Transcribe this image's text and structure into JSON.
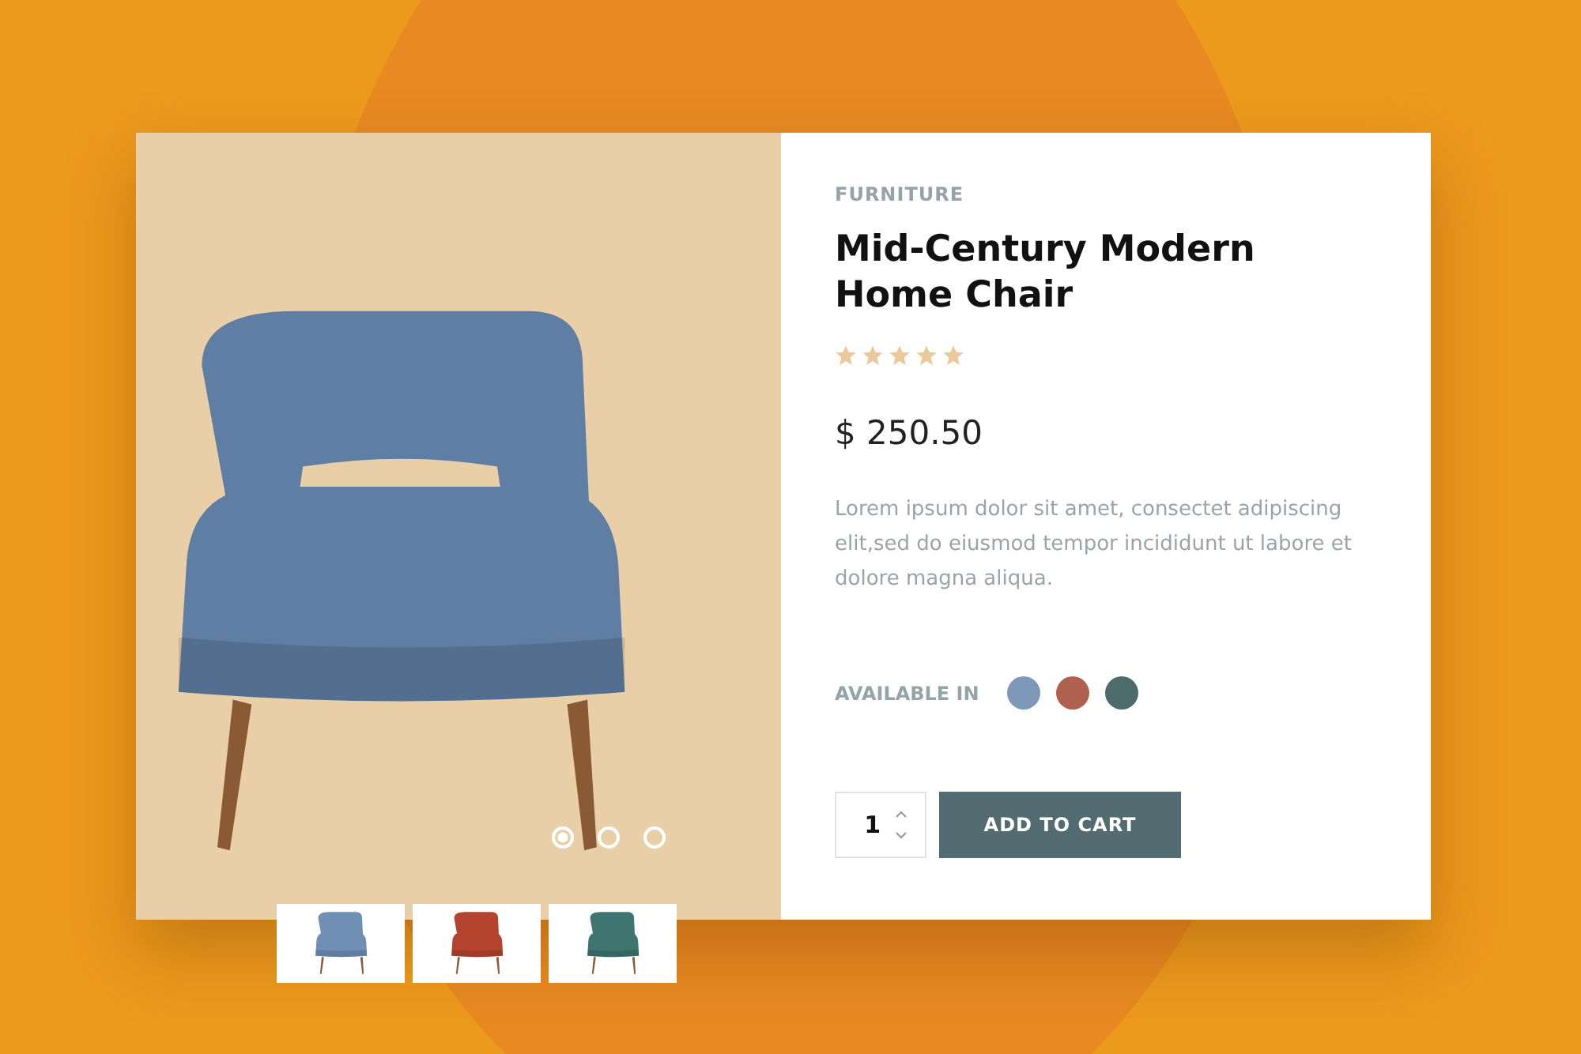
{
  "product": {
    "category": "FURNITURE",
    "title": "Mid-Century Modern Home Chair",
    "stars": 5,
    "price": "$ 250.50",
    "description": "Lorem ipsum dolor sit amet, consectet adipiscing elit,sed do eiusmod tempor incididunt ut labore et dolore magna aliqua."
  },
  "gallery": {
    "slides": [
      {
        "selected": true
      },
      {
        "selected": false
      },
      {
        "selected": false
      }
    ],
    "thumbnails": [
      {
        "color": "#6f8fb5"
      },
      {
        "color": "#b4442f"
      },
      {
        "color": "#3f7570"
      }
    ]
  },
  "availability": {
    "label": "AVAILABLE IN",
    "colors": [
      {
        "color": "#7d98b8"
      },
      {
        "color": "#b0604e"
      },
      {
        "color": "#4d6b6a"
      }
    ]
  },
  "cart": {
    "quantity": "1",
    "button": "ADD TO CART"
  }
}
